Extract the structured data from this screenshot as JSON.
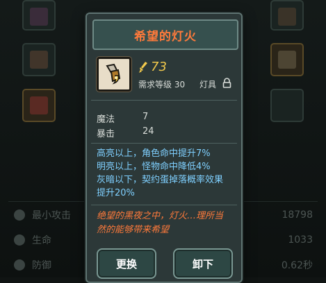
{
  "popup": {
    "title": "希望的灯火",
    "item_icon": "lamp-icon",
    "power_value": "73",
    "power_icon": "sword-power-icon",
    "requirement": "需求等级 30",
    "item_type": "灯具",
    "lock_icon": "lock-icon",
    "stats": [
      {
        "label": "魔法",
        "value": "7"
      },
      {
        "label": "暴击",
        "value": "24"
      }
    ],
    "effects": [
      "高亮以上，角色命中提升7%",
      "明亮以上，怪物命中降低4%",
      "灰暗以下，契约蛋掉落概率效果",
      "提升20%"
    ],
    "flavor_lines": [
      "绝望的黑夜之中，灯火…理所当",
      "然的能够带来希望"
    ],
    "buttons": {
      "replace": "更换",
      "unequip": "卸下"
    }
  },
  "background": {
    "stats": [
      {
        "label": "最小攻击",
        "value": "18798",
        "icon": "attack-icon"
      },
      {
        "label": "生命",
        "value": "1033",
        "icon": "heart-icon"
      },
      {
        "label": "防御",
        "value": "0.62秒",
        "icon": "shield-icon"
      }
    ]
  },
  "colors": {
    "title": "#ff7a3b",
    "power": "#f2c94c",
    "effect": "#7fd0ff",
    "flavor": "#ff7a3b"
  }
}
